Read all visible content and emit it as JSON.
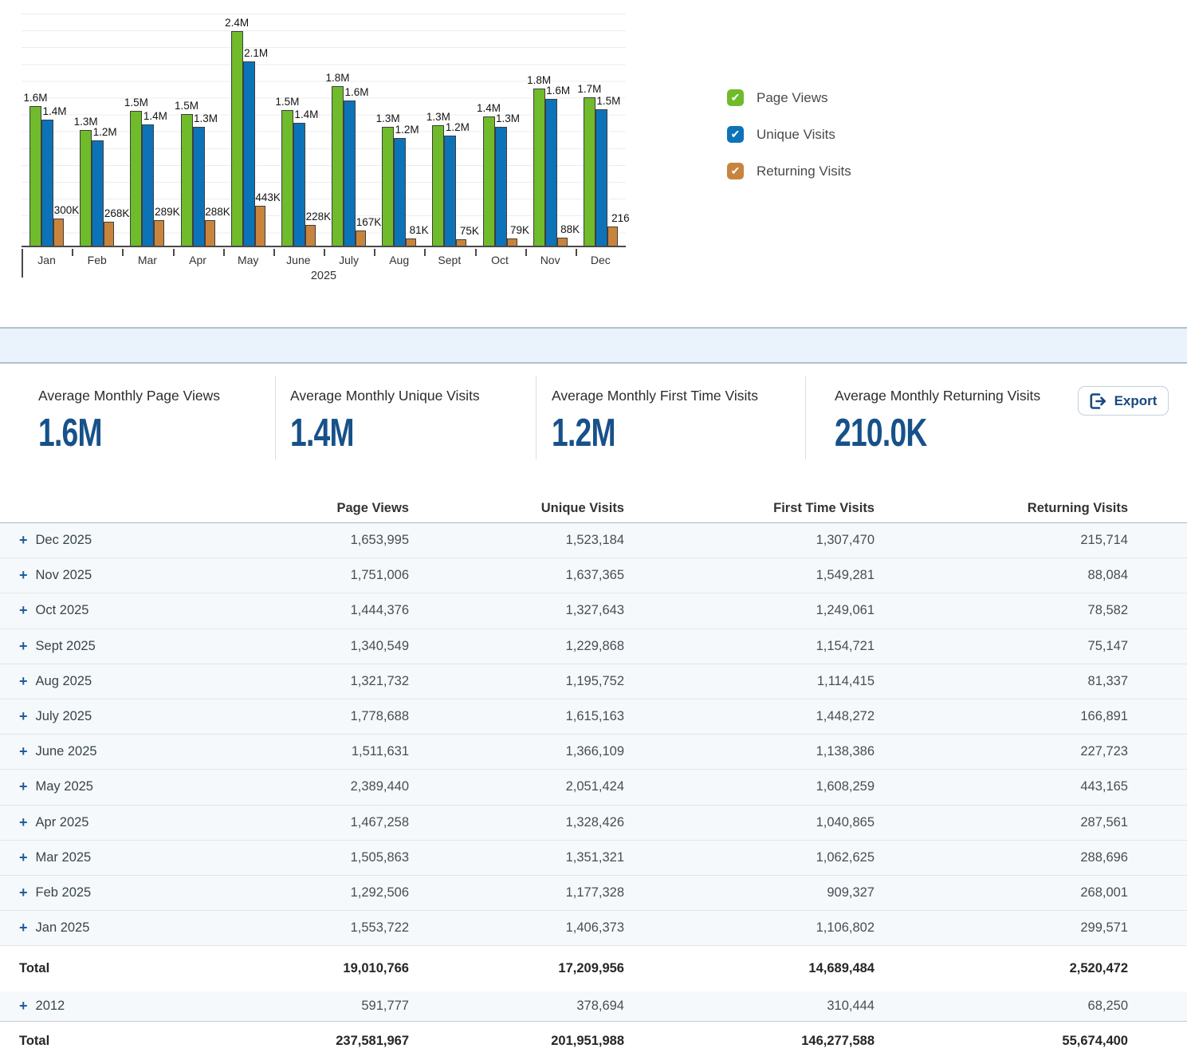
{
  "chart_data": {
    "type": "bar",
    "categories": [
      "Jan",
      "Feb",
      "Mar",
      "Apr",
      "May",
      "June",
      "July",
      "Aug",
      "Sept",
      "Oct",
      "Nov",
      "Dec"
    ],
    "year_label": "2025",
    "ylim": [
      0,
      2650000
    ],
    "grid": "horizontal",
    "legend_position": "right",
    "series": [
      {
        "name": "Page Views",
        "color": "#6fbb2c",
        "values": [
          1553722,
          1292506,
          1505863,
          1467258,
          2389440,
          1511631,
          1778688,
          1321732,
          1340549,
          1444376,
          1751006,
          1653995
        ],
        "labels": [
          "1.6M",
          "1.3M",
          "1.5M",
          "1.5M",
          "2.4M",
          "1.5M",
          "1.8M",
          "1.3M",
          "1.3M",
          "1.4M",
          "1.8M",
          "1.7M"
        ]
      },
      {
        "name": "Unique Visits",
        "color": "#0d73b9",
        "values": [
          1406373,
          1177328,
          1351321,
          1328426,
          2051424,
          1366109,
          1615163,
          1195752,
          1229868,
          1327643,
          1637365,
          1523184
        ],
        "labels": [
          "1.4M",
          "1.2M",
          "1.4M",
          "1.3M",
          "2.1M",
          "1.4M",
          "1.6M",
          "1.2M",
          "1.2M",
          "1.3M",
          "1.6M",
          "1.5M"
        ]
      },
      {
        "name": "Returning Visits",
        "color": "#c8843d",
        "values": [
          299571,
          268001,
          288696,
          287561,
          443165,
          227723,
          166891,
          81337,
          75147,
          78582,
          88084,
          215714
        ],
        "labels": [
          "300K",
          "268K",
          "289K",
          "288K",
          "443K",
          "228K",
          "167K",
          "81K",
          "75K",
          "79K",
          "88K",
          "216"
        ]
      }
    ]
  },
  "legend": {
    "items": [
      {
        "label": "Page Views",
        "color": "#6fbb2c",
        "checked": true
      },
      {
        "label": "Unique Visits",
        "color": "#0d73b9",
        "checked": true
      },
      {
        "label": "Returning Visits",
        "color": "#c8843d",
        "checked": true
      }
    ],
    "check_glyph": "✔"
  },
  "summary_cards": [
    {
      "title": "Average Monthly Page Views",
      "value": "1.6M"
    },
    {
      "title": "Average Monthly Unique Visits",
      "value": "1.4M"
    },
    {
      "title": "Average Monthly First Time Visits",
      "value": "1.2M"
    },
    {
      "title": "Average Monthly Returning Visits",
      "value": "210.0K"
    }
  ],
  "export_label": "Export",
  "accent_colors": {
    "navy": "#17518a",
    "green": "#6fbb2c",
    "blue": "#0d73b9",
    "orange": "#c8843d"
  },
  "table": {
    "columns": [
      "Page Views",
      "Unique Visits",
      "First Time Visits",
      "Returning Visits"
    ],
    "plus_glyph": "+",
    "rows": [
      {
        "label": "Dec 2025",
        "values": [
          "1,653,995",
          "1,523,184",
          "1,307,470",
          "215,714"
        ]
      },
      {
        "label": "Nov 2025",
        "values": [
          "1,751,006",
          "1,637,365",
          "1,549,281",
          "88,084"
        ]
      },
      {
        "label": "Oct 2025",
        "values": [
          "1,444,376",
          "1,327,643",
          "1,249,061",
          "78,582"
        ]
      },
      {
        "label": "Sept 2025",
        "values": [
          "1,340,549",
          "1,229,868",
          "1,154,721",
          "75,147"
        ]
      },
      {
        "label": "Aug 2025",
        "values": [
          "1,321,732",
          "1,195,752",
          "1,114,415",
          "81,337"
        ]
      },
      {
        "label": "July 2025",
        "values": [
          "1,778,688",
          "1,615,163",
          "1,448,272",
          "166,891"
        ]
      },
      {
        "label": "June 2025",
        "values": [
          "1,511,631",
          "1,366,109",
          "1,138,386",
          "227,723"
        ]
      },
      {
        "label": "May 2025",
        "values": [
          "2,389,440",
          "2,051,424",
          "1,608,259",
          "443,165"
        ]
      },
      {
        "label": "Apr 2025",
        "values": [
          "1,467,258",
          "1,328,426",
          "1,040,865",
          "287,561"
        ]
      },
      {
        "label": "Mar 2025",
        "values": [
          "1,505,863",
          "1,351,321",
          "1,062,625",
          "288,696"
        ]
      },
      {
        "label": "Feb 2025",
        "values": [
          "1,292,506",
          "1,177,328",
          "909,327",
          "268,001"
        ]
      },
      {
        "label": "Jan 2025",
        "values": [
          "1,553,722",
          "1,406,373",
          "1,106,802",
          "299,571"
        ]
      }
    ],
    "total_2025": {
      "label": "Total",
      "values": [
        "19,010,766",
        "17,209,956",
        "14,689,484",
        "2,520,472"
      ]
    },
    "row_2012": {
      "label": "2012",
      "values": [
        "591,777",
        "378,694",
        "310,444",
        "68,250"
      ]
    },
    "grand_total": {
      "label": "Total",
      "values": [
        "237,581,967",
        "201,951,988",
        "146,277,588",
        "55,674,400"
      ]
    }
  }
}
